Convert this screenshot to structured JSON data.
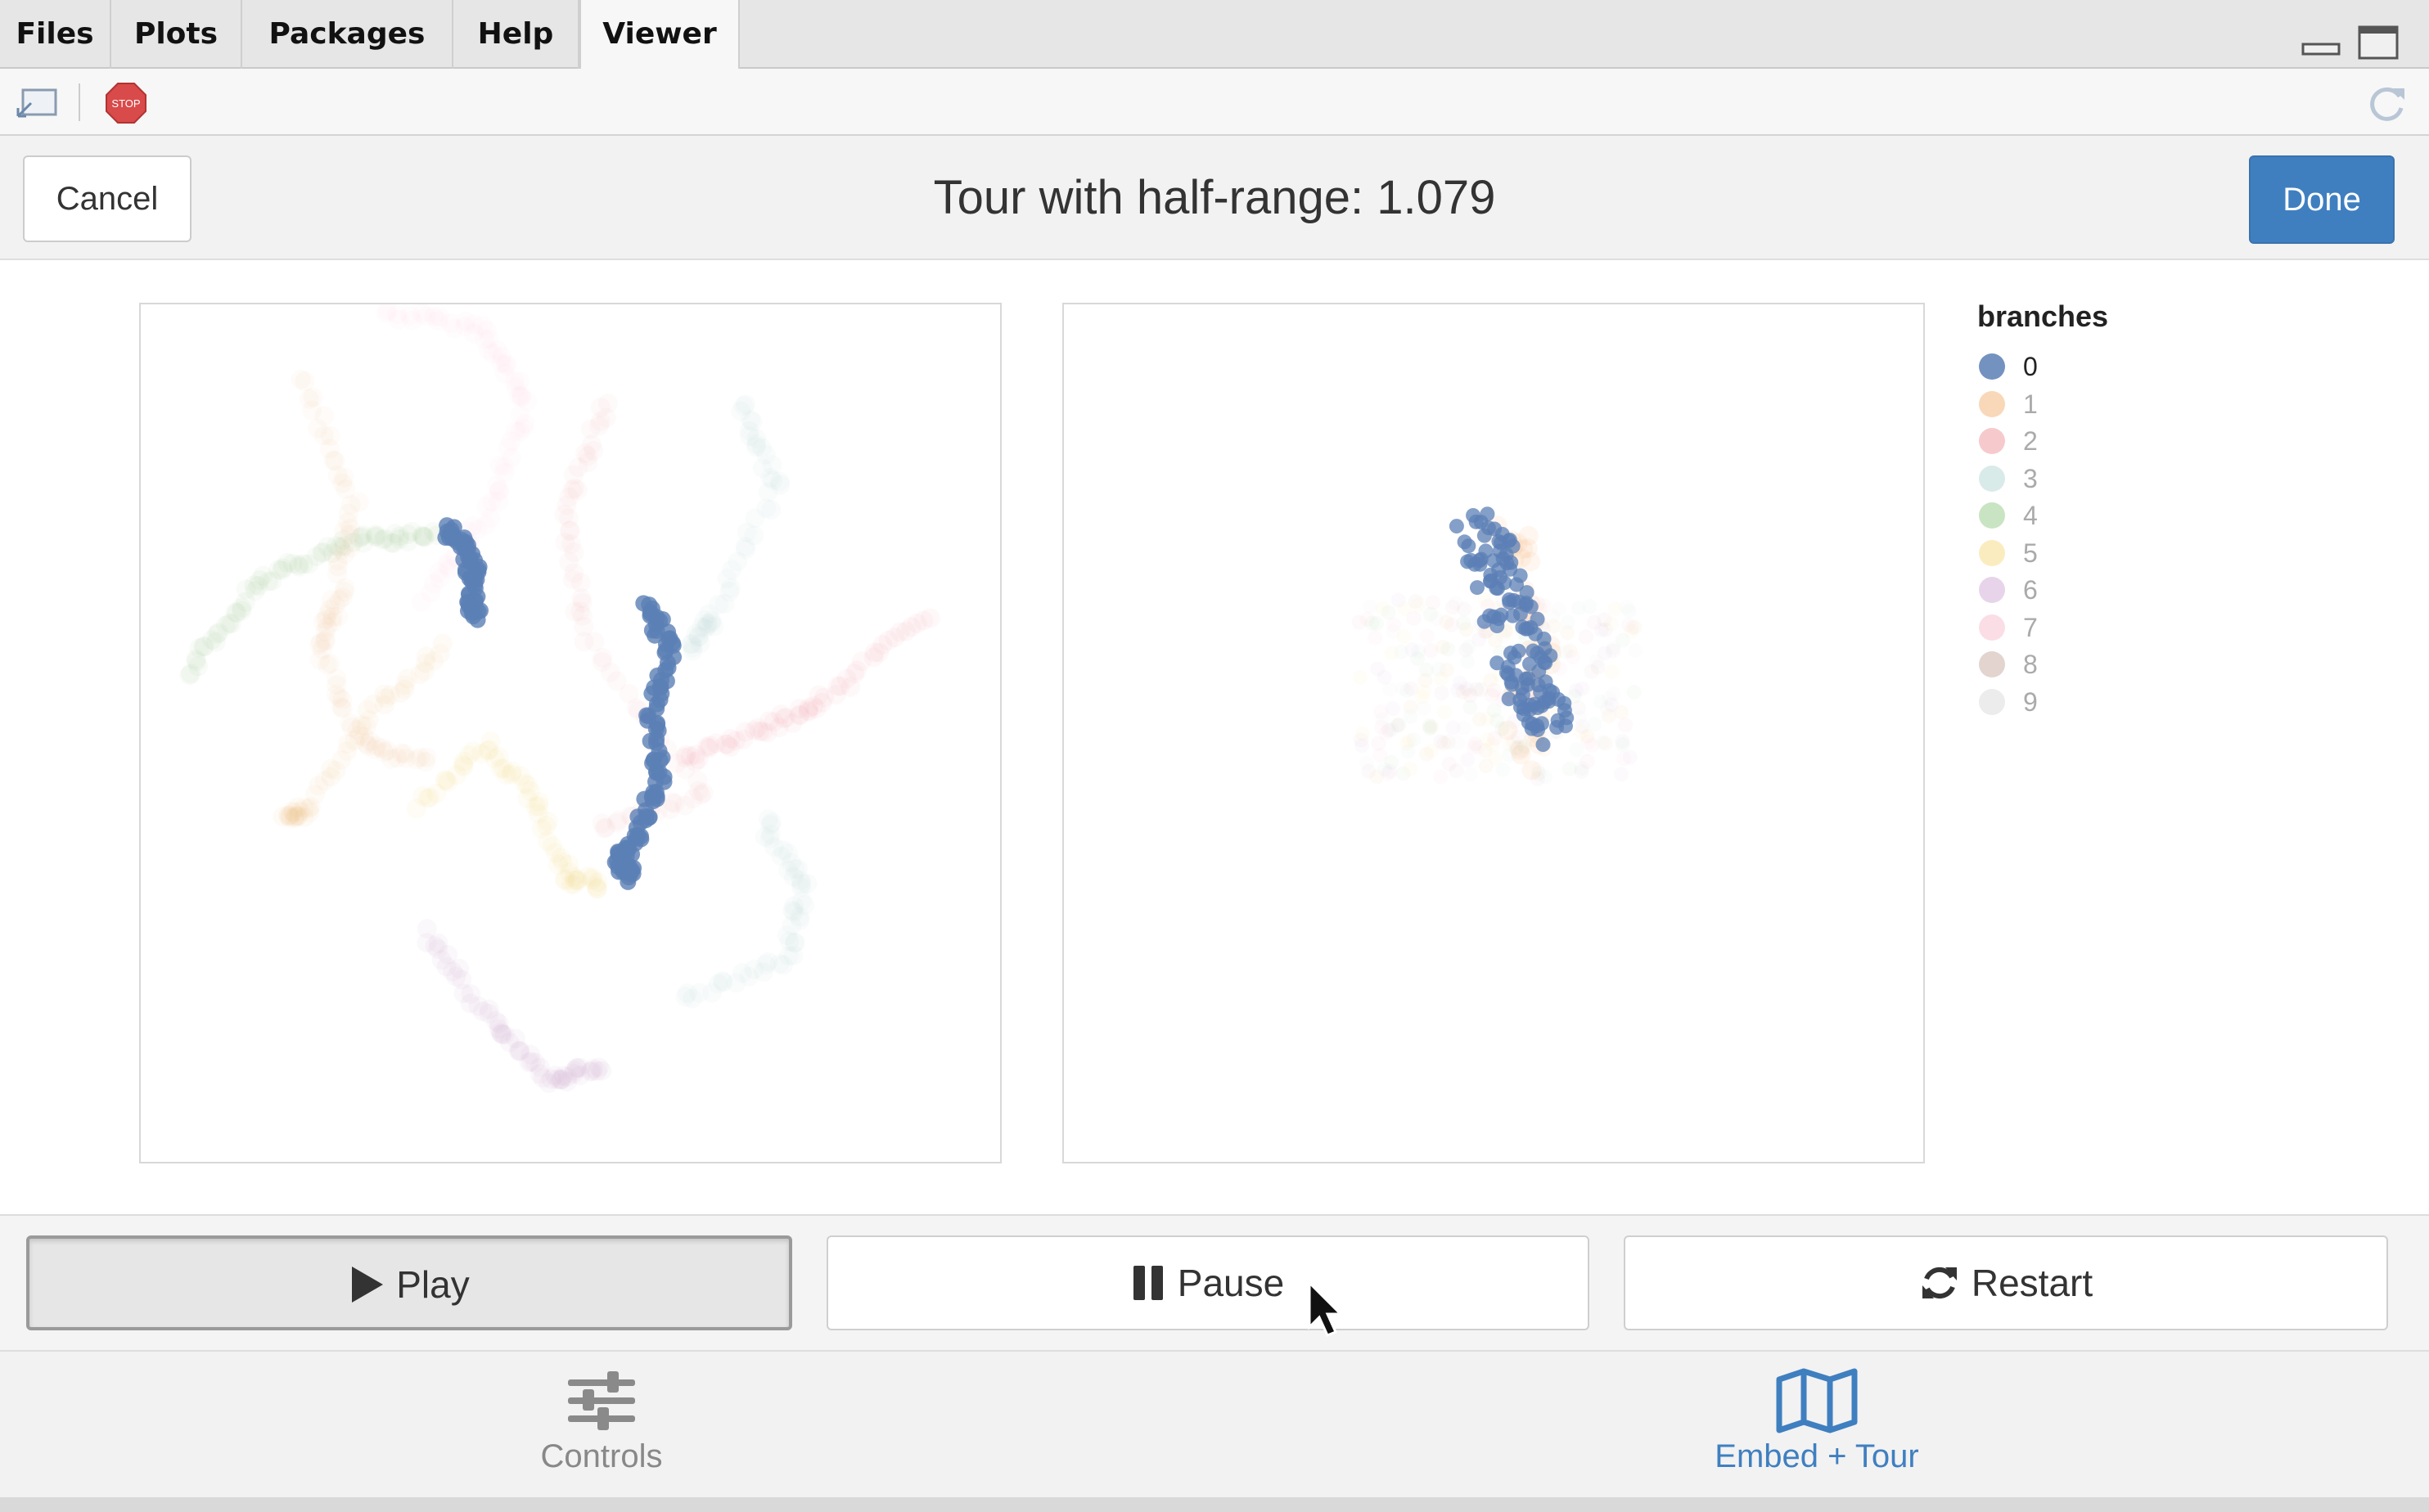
{
  "tabs": [
    "Files",
    "Plots",
    "Packages",
    "Help",
    "Viewer"
  ],
  "active_tab": "Viewer",
  "toolbar": {
    "stop_icon_text": "STOP"
  },
  "header": {
    "cancel_label": "Cancel",
    "title": "Tour with half-range: 1.079",
    "done_label": "Done"
  },
  "legend": {
    "title": "branches",
    "items": [
      {
        "label": "0",
        "color": "#5b7fb5"
      },
      {
        "label": "1",
        "color": "#f4b77f"
      },
      {
        "label": "2",
        "color": "#ee9fa3"
      },
      {
        "label": "3",
        "color": "#b9dbd7"
      },
      {
        "label": "4",
        "color": "#9ccd91"
      },
      {
        "label": "5",
        "color": "#f8dc8c"
      },
      {
        "label": "6",
        "color": "#d3b1d8"
      },
      {
        "label": "7",
        "color": "#f8c2cf"
      },
      {
        "label": "8",
        "color": "#ccb1a7"
      },
      {
        "label": "9",
        "color": "#dddddd"
      }
    ]
  },
  "controls": {
    "play_label": "Play",
    "pause_label": "Pause",
    "restart_label": "Restart"
  },
  "bottom_nav": [
    {
      "label": "Controls",
      "icon": "sliders-icon",
      "color": "#888888"
    },
    {
      "label": "Embed + Tour",
      "icon": "map-icon",
      "color": "#3f7fc0"
    }
  ]
}
